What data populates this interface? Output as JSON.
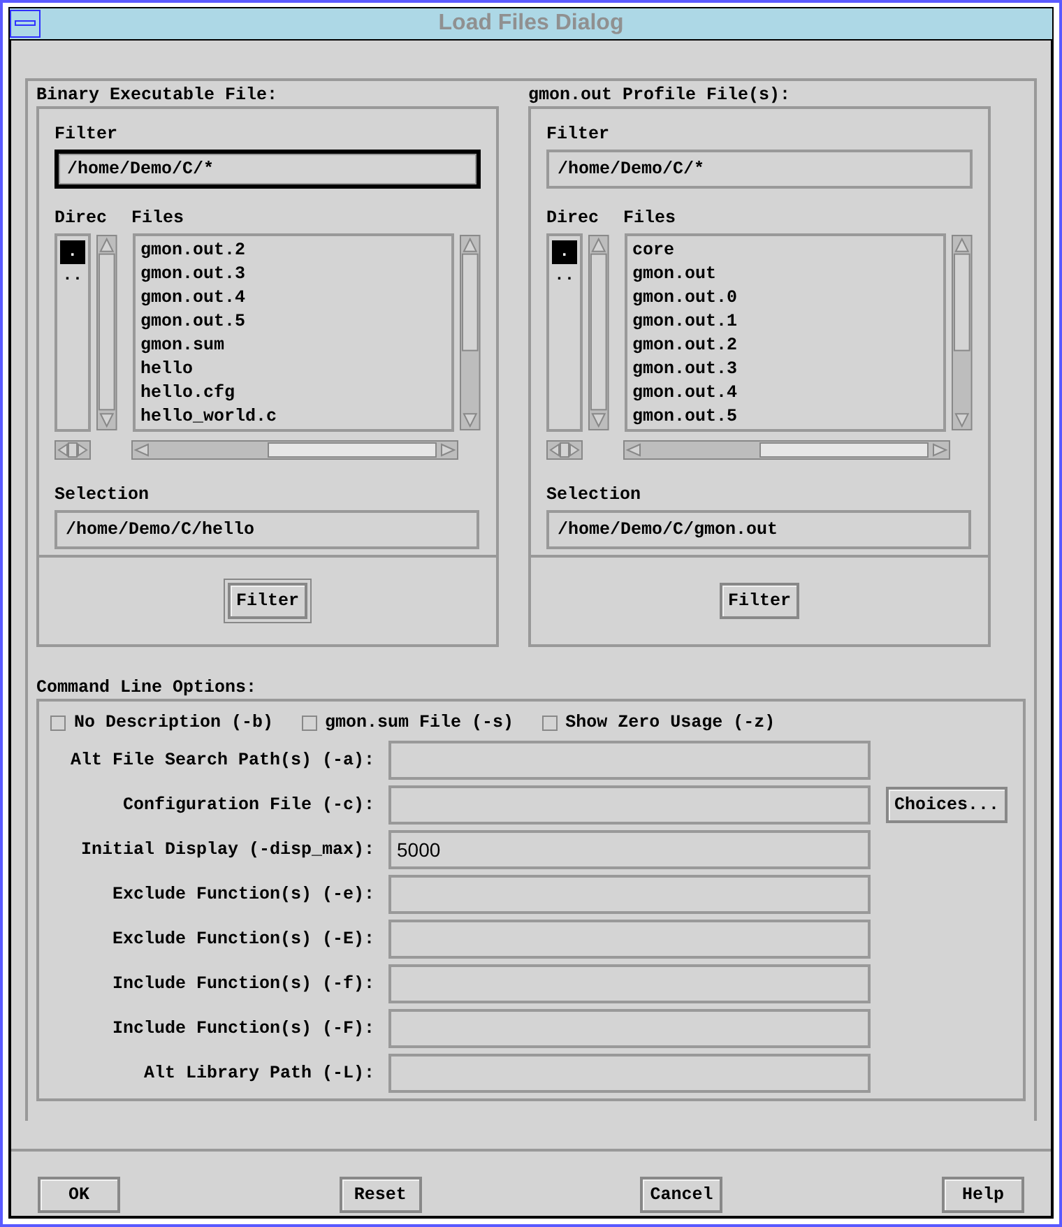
{
  "window": {
    "title": "Load Files Dialog"
  },
  "panels": [
    {
      "title": "Binary Executable File:",
      "filter_label": "Filter",
      "filter": "/home/Demo/C/*",
      "filter_focused": true,
      "directories_label": "Direc",
      "files_label": "Files",
      "directories": [
        {
          "name": ".",
          "selected": true
        },
        {
          "name": "..",
          "selected": false
        }
      ],
      "files": [
        "gmon.out.2",
        "gmon.out.3",
        "gmon.out.4",
        "gmon.out.5",
        "gmon.sum",
        "hello",
        "hello.cfg",
        "hello_world.c"
      ],
      "selection_label": "Selection",
      "selection": "/home/Demo/C/hello",
      "button": "Filter",
      "button_default": true
    },
    {
      "title": "gmon.out Profile File(s):",
      "filter_label": "Filter",
      "filter": "/home/Demo/C/*",
      "filter_focused": false,
      "directories_label": "Direc",
      "files_label": "Files",
      "directories": [
        {
          "name": ".",
          "selected": true
        },
        {
          "name": "..",
          "selected": false
        }
      ],
      "files": [
        "core",
        "gmon.out",
        "gmon.out.0",
        "gmon.out.1",
        "gmon.out.2",
        "gmon.out.3",
        "gmon.out.4",
        "gmon.out.5"
      ],
      "selection_label": "Selection",
      "selection": "/home/Demo/C/gmon.out",
      "button": "Filter",
      "button_default": false
    }
  ],
  "options": {
    "title": "Command Line Options:",
    "checkboxes": [
      {
        "label": "No Description (-b)",
        "checked": false
      },
      {
        "label": "gmon.sum File (-s)",
        "checked": false
      },
      {
        "label": "Show Zero Usage (-z)",
        "checked": false
      }
    ],
    "fields": [
      {
        "label": "Alt File Search Path(s) (-a):"
      },
      {
        "label": "Configuration File (-c):",
        "button": "Choices..."
      },
      {
        "label": "Initial Display (-disp_max):",
        "value": "5000"
      },
      {
        "label": "Exclude Function(s) (-e):"
      },
      {
        "label": "Exclude Function(s) (-E):"
      },
      {
        "label": "Include Function(s) (-f):"
      },
      {
        "label": "Include Function(s) (-F):"
      },
      {
        "label": "Alt Library Path (-L):"
      }
    ]
  },
  "buttons": [
    "OK",
    "Reset",
    "Cancel",
    "Help"
  ]
}
